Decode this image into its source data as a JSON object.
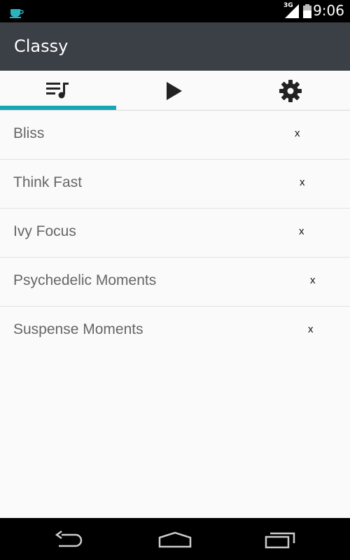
{
  "status_bar": {
    "network": "3G",
    "time": "9:06",
    "icons": [
      "app-notification-icon",
      "signal-icon",
      "battery-icon"
    ]
  },
  "app_bar": {
    "title": "Classy"
  },
  "tabs": [
    {
      "icon": "playlist-icon",
      "selected": true
    },
    {
      "icon": "play-icon",
      "selected": false
    },
    {
      "icon": "settings-gear-icon",
      "selected": false
    }
  ],
  "colors": {
    "app_bar": "#3b3f46",
    "tab_indicator": "#16a6b6",
    "background": "#fafafa"
  },
  "playlists": [
    {
      "label": "Bliss",
      "remove": "x"
    },
    {
      "label": "Think Fast",
      "remove": "x"
    },
    {
      "label": "Ivy Focus",
      "remove": "x"
    },
    {
      "label": "Psychedelic Moments",
      "remove": "x"
    },
    {
      "label": "Suspense Moments",
      "remove": "x"
    }
  ],
  "nav_bar": {
    "buttons": [
      "back-icon",
      "home-icon",
      "recents-icon"
    ]
  }
}
